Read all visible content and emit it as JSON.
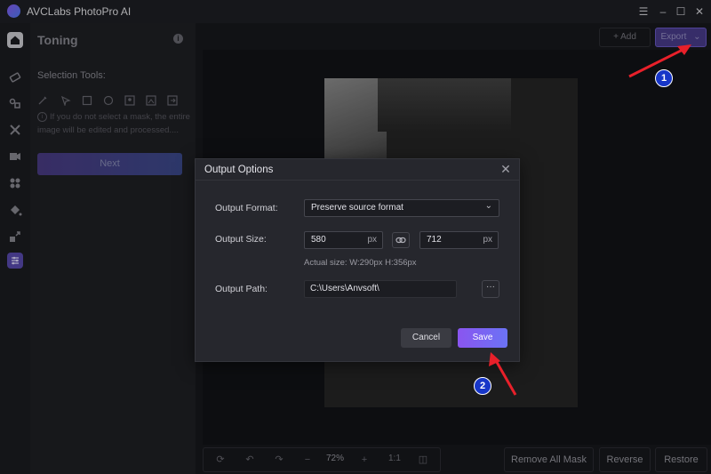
{
  "app": {
    "title": "AVCLabs PhotoPro AI"
  },
  "window_controls": {
    "menu": "☰",
    "minimize": "–",
    "maximize": "☐",
    "close": "✕"
  },
  "panel": {
    "title": "Toning",
    "selection_tools_label": "Selection Tools:",
    "hint": "If you do not select a mask, the entire image will be edited and processed....",
    "next_label": "Next"
  },
  "topbar": {
    "add_label": "+ Add",
    "export_label": "Export"
  },
  "bottombar": {
    "zoom": "72%",
    "ratio": "1:1",
    "remove_all_mask": "Remove All Mask",
    "reverse": "Reverse",
    "restore": "Restore"
  },
  "dialog": {
    "title": "Output Options",
    "format_label": "Output Format:",
    "format_value": "Preserve source format",
    "size_label": "Output Size:",
    "width": "580",
    "height": "712",
    "unit": "px",
    "actual_size": "Actual size:  W:290px   H:356px",
    "path_label": "Output Path:",
    "path_value": "C:\\Users\\Anvsoft\\",
    "browse": "···",
    "cancel": "Cancel",
    "save": "Save"
  },
  "annotations": {
    "step1": "1",
    "step2": "2"
  },
  "colors": {
    "accent": "#8a55f0",
    "arrow": "#e8202a",
    "badge": "#1736c8"
  },
  "icons": [
    "home-icon",
    "eraser-icon",
    "retouch-icon",
    "enhance-icon",
    "object-remove-icon",
    "colorize-icon",
    "fill-icon",
    "upscale-icon",
    "toning-icon"
  ]
}
